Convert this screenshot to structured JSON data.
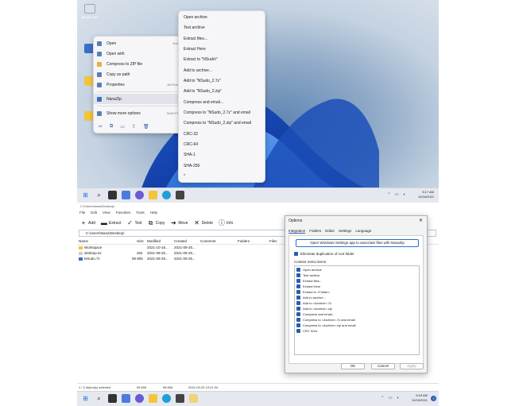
{
  "top": {
    "desktop_icons": [
      {
        "label": "Recycle Bin",
        "kind": "recycle-bin"
      },
      {
        "label": "",
        "kind": "app"
      },
      {
        "label": "",
        "kind": "folder"
      },
      {
        "label": "",
        "kind": "folder"
      }
    ],
    "context_menu": {
      "items": [
        {
          "label": "Open",
          "shortcut": "Enter",
          "arrow": ""
        },
        {
          "label": "Open with",
          "shortcut": "",
          "arrow": "›"
        },
        {
          "label": "Compress to ZIP file",
          "shortcut": "",
          "arrow": ""
        },
        {
          "label": "Copy as path",
          "shortcut": "",
          "arrow": ""
        },
        {
          "label": "Properties",
          "shortcut": "Alt+Enter",
          "arrow": ""
        },
        {
          "label": "NanaZip",
          "shortcut": "",
          "arrow": "›"
        },
        {
          "label": "Show more options",
          "shortcut": "Shift+F10",
          "arrow": ""
        }
      ],
      "bottom_icons": [
        "✂",
        "⧉",
        "▭",
        "⇪",
        "🗑"
      ]
    },
    "submenu": [
      "Open archive",
      "Test archive",
      "Extract files...",
      "Extract Here",
      "Extract to \"NSudo\\\"",
      "Add to archive...",
      "Add to \"NSudo_2.7z\"",
      "Add to \"NSudo_2.zip\"",
      "Compress and email...",
      "Compress to \"NSudo_2.7z\" and email",
      "Compress to \"NSudo_2.zip\" and email",
      "CRC-32",
      "CRC-64",
      "SHA-1",
      "SHA-256",
      "*"
    ],
    "tray": {
      "time": "5:17 AM",
      "date": "10/16/2021"
    }
  },
  "bottom": {
    "title": "C:\\Users\\Nana\\Desktop\\",
    "menu": [
      "File",
      "Edit",
      "View",
      "Favorites",
      "Tools",
      "Help"
    ],
    "toolbar": [
      {
        "label": "Add",
        "icon": "+"
      },
      {
        "label": "Extract",
        "icon": "▬"
      },
      {
        "label": "Test",
        "icon": "✓"
      },
      {
        "label": "Copy",
        "icon": "⧉"
      },
      {
        "label": "Move",
        "icon": "➜"
      },
      {
        "label": "Delete",
        "icon": "✕"
      },
      {
        "label": "Info",
        "icon": "ⓘ"
      }
    ],
    "path": "C:\\Users\\Nana\\Desktop\\",
    "columns": [
      "Name",
      "Size",
      "Modified",
      "Created",
      "Comment",
      "Folders",
      "Files"
    ],
    "rows": [
      {
        "name": "Workspace",
        "size": "",
        "modified": "2021-10-16...",
        "created": "2021-09-25..."
      },
      {
        "name": "desktop.ini",
        "size": "282",
        "modified": "2021-09-25...",
        "created": "2021-09-25..."
      },
      {
        "name": "NSudo.7z",
        "size": "98 806",
        "modified": "2021-09-25...",
        "created": "2021-09-25..."
      }
    ],
    "status": {
      "selected": "1 / 3 object(s) selected",
      "size1": "98 806",
      "size2": "98 806",
      "date": "2021-09-25 19:21:34"
    },
    "tray": {
      "time": "5:18 AM",
      "date": "10/16/2021",
      "badge": "3"
    },
    "dialog": {
      "title": "Options",
      "close": "✕",
      "tabs": [
        "Integration",
        "Folders",
        "Editor",
        "Settings",
        "Language"
      ],
      "wide_button": "Open Windows Settings app to associate files with NanaZip",
      "eliminate": "Eliminate duplication of root folder",
      "context_items_label": "Context menu items:",
      "items": [
        "Open archive",
        "Test archive",
        "Extract files...",
        "Extract Here",
        "Extract to <Folder>",
        "Add to archive...",
        "Add to <Archive>.7z",
        "Add to <Archive>.zip",
        "Compress and email...",
        "Compress to <Archive>.7z and email",
        "Compress to <Archive>.zip and email",
        "CRC SHA"
      ],
      "ok": "OK",
      "cancel": "Cancel",
      "apply": "Apply"
    }
  },
  "colors": {
    "accent": "#2a5db0",
    "folder": "#f3c53d"
  }
}
